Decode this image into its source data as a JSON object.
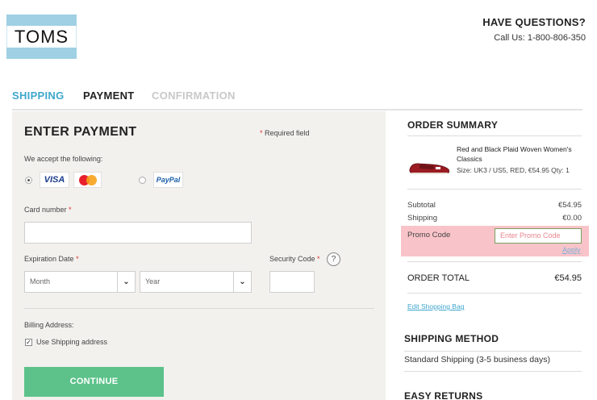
{
  "brand": {
    "logo_text": "TOMS"
  },
  "help": {
    "title": "HAVE QUESTIONS?",
    "phone": "Call Us: 1-800-806-350"
  },
  "steps": [
    {
      "label": "SHIPPING",
      "state": "done"
    },
    {
      "label": "PAYMENT",
      "state": "active"
    },
    {
      "label": "CONFIRMATION",
      "state": "upcoming"
    }
  ],
  "payment": {
    "title": "ENTER PAYMENT",
    "required_star": "*",
    "required_text": "Required field",
    "accept_label": "We accept the following:",
    "methods": [
      {
        "name": "VISA",
        "icon": "visa-icon",
        "selected": true
      },
      {
        "name": "MasterCard",
        "icon": "mastercard-icon",
        "selected": true
      },
      {
        "name": "PayPal",
        "icon": "paypal-icon",
        "selected": false
      }
    ],
    "card_number_label": "Card number",
    "card_number_value": "",
    "expiration_label": "Expiration Date",
    "month_value": "Month",
    "year_value": "Year",
    "security_label": "Security Code",
    "security_help": "?",
    "security_value": "",
    "billing_label": "Billing Address:",
    "use_shipping_label": "Use Shipping address",
    "use_shipping_checked": true,
    "continue_label": "CONTINUE",
    "colors": {
      "primary_button": "#5cc28a",
      "active_step": "#3ea6cc"
    }
  },
  "summary": {
    "title": "ORDER SUMMARY",
    "product": {
      "name": "Red and Black Plaid Woven Women's Classics",
      "meta": "Size: UK3 / US5, RED, €54.95 Qty: 1",
      "image": "red-plaid-shoe"
    },
    "subtotal_label": "Subtotal",
    "subtotal_value": "€54.95",
    "shipping_label": "Shipping",
    "shipping_value": "€0.00",
    "promo_label": "Promo Code",
    "promo_placeholder": "Enter Promo Code",
    "apply_label": "Apply",
    "total_label": "ORDER TOTAL",
    "total_value": "€54.95",
    "edit_bag_label": "Edit Shopping Bag"
  },
  "shipping_method": {
    "title": "SHIPPING METHOD",
    "value": "Standard Shipping (3-5 business days)"
  },
  "easy_returns": {
    "title": "EASY RETURNS"
  }
}
